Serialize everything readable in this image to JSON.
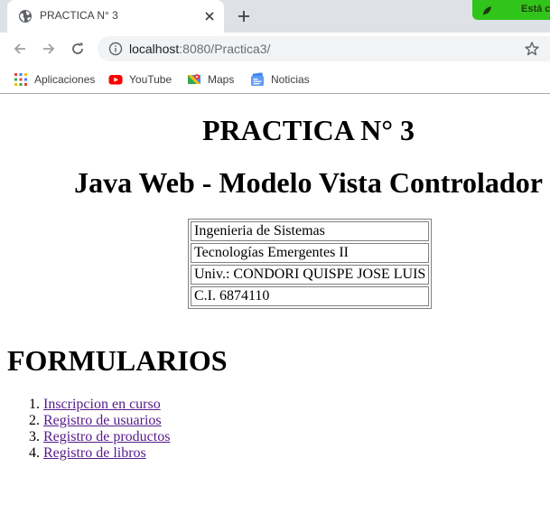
{
  "browser": {
    "tab": {
      "title": "PRACTICA N° 3",
      "favicon": "globe-icon"
    },
    "extension_badge": {
      "text": "Está c",
      "color": "#31c41a"
    },
    "address_bar": {
      "host": "localhost",
      "rest": ":8080/Practica3/"
    },
    "bookmarks": [
      {
        "label": "Aplicaciones",
        "icon": "apps-grid-icon"
      },
      {
        "label": "YouTube",
        "icon": "youtube-icon"
      },
      {
        "label": "Maps",
        "icon": "maps-icon"
      },
      {
        "label": "Noticias",
        "icon": "news-icon"
      }
    ]
  },
  "page": {
    "title": "PRACTICA N° 3",
    "subtitle": "Java Web - Modelo Vista Controlador",
    "info_rows": [
      "Ingenieria de Sistemas",
      "Tecnologías Emergentes II",
      "Univ.: CONDORI QUISPE JOSE LUIS",
      "C.I. 6874110"
    ],
    "section_title": "FORMULARIOS",
    "forms": [
      "Inscripcion en curso",
      "Registro de usuarios",
      "Registro de productos",
      "Registro de libros"
    ],
    "link_color": "#551a8b"
  }
}
